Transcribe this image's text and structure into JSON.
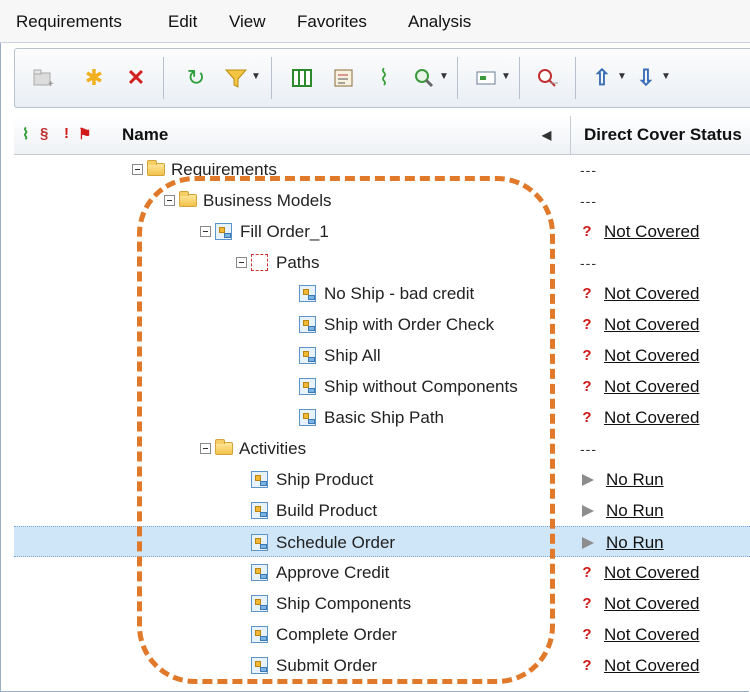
{
  "menu": [
    "Requirements",
    "Edit",
    "View",
    "Favorites",
    "Analysis"
  ],
  "columns": {
    "name": "Name",
    "status": "Direct Cover Status"
  },
  "colors": {
    "accent": "#e07a2a",
    "selection": "#cfe6f8",
    "not_covered": "#d01818"
  },
  "rows": [
    {
      "label": "Requirements",
      "icon": "folder",
      "level": 0,
      "expander": true,
      "status_icon": "dash",
      "status": "---"
    },
    {
      "label": "Business Models",
      "icon": "folder",
      "level": 1,
      "expander": true,
      "status_icon": "dash",
      "status": "---"
    },
    {
      "label": "Fill Order_1",
      "icon": "model",
      "level": 2,
      "expander": true,
      "status_icon": "question",
      "status": "Not Covered"
    },
    {
      "label": "Paths",
      "icon": "paths",
      "level": 3,
      "expander": true,
      "status_icon": "dash",
      "status": "---"
    },
    {
      "label": "No Ship - bad credit",
      "icon": "model",
      "level": 4,
      "expander": false,
      "status_icon": "question",
      "status": "Not Covered"
    },
    {
      "label": "Ship with Order Check",
      "icon": "model",
      "level": 4,
      "expander": false,
      "status_icon": "question",
      "status": "Not Covered"
    },
    {
      "label": "Ship All",
      "icon": "model",
      "level": 4,
      "expander": false,
      "status_icon": "question",
      "status": "Not Covered"
    },
    {
      "label": "Ship without Components",
      "icon": "model",
      "level": 4,
      "expander": false,
      "status_icon": "question",
      "status": "Not Covered"
    },
    {
      "label": "Basic Ship Path",
      "icon": "model",
      "level": 4,
      "expander": false,
      "status_icon": "question",
      "status": "Not Covered"
    },
    {
      "label": "Activities",
      "icon": "folder",
      "level": 2,
      "expander": true,
      "status_icon": "dash",
      "status": "---"
    },
    {
      "label": "Ship Product",
      "icon": "model",
      "level": 3,
      "expander": false,
      "status_icon": "play",
      "status": "No Run"
    },
    {
      "label": "Build Product",
      "icon": "model",
      "level": 3,
      "expander": false,
      "status_icon": "play",
      "status": "No Run"
    },
    {
      "label": "Schedule Order",
      "icon": "model",
      "level": 3,
      "expander": false,
      "status_icon": "play",
      "status": "No Run",
      "selected": true
    },
    {
      "label": "Approve Credit",
      "icon": "model",
      "level": 3,
      "expander": false,
      "status_icon": "question",
      "status": "Not Covered"
    },
    {
      "label": "Ship Components",
      "icon": "model",
      "level": 3,
      "expander": false,
      "status_icon": "question",
      "status": "Not Covered"
    },
    {
      "label": "Complete Order",
      "icon": "model",
      "level": 3,
      "expander": false,
      "status_icon": "question",
      "status": "Not Covered"
    },
    {
      "label": "Submit Order",
      "icon": "model",
      "level": 3,
      "expander": false,
      "status_icon": "question",
      "status": "Not Covered"
    }
  ],
  "toolbar_icons": [
    "new-folder-icon",
    "new-requirement-icon",
    "delete-icon",
    "refresh-icon",
    "filter-icon",
    "columns-icon",
    "details-icon",
    "attachment-icon",
    "zoom-icon",
    "view-icon",
    "find-icon",
    "move-up-icon",
    "move-down-icon"
  ]
}
